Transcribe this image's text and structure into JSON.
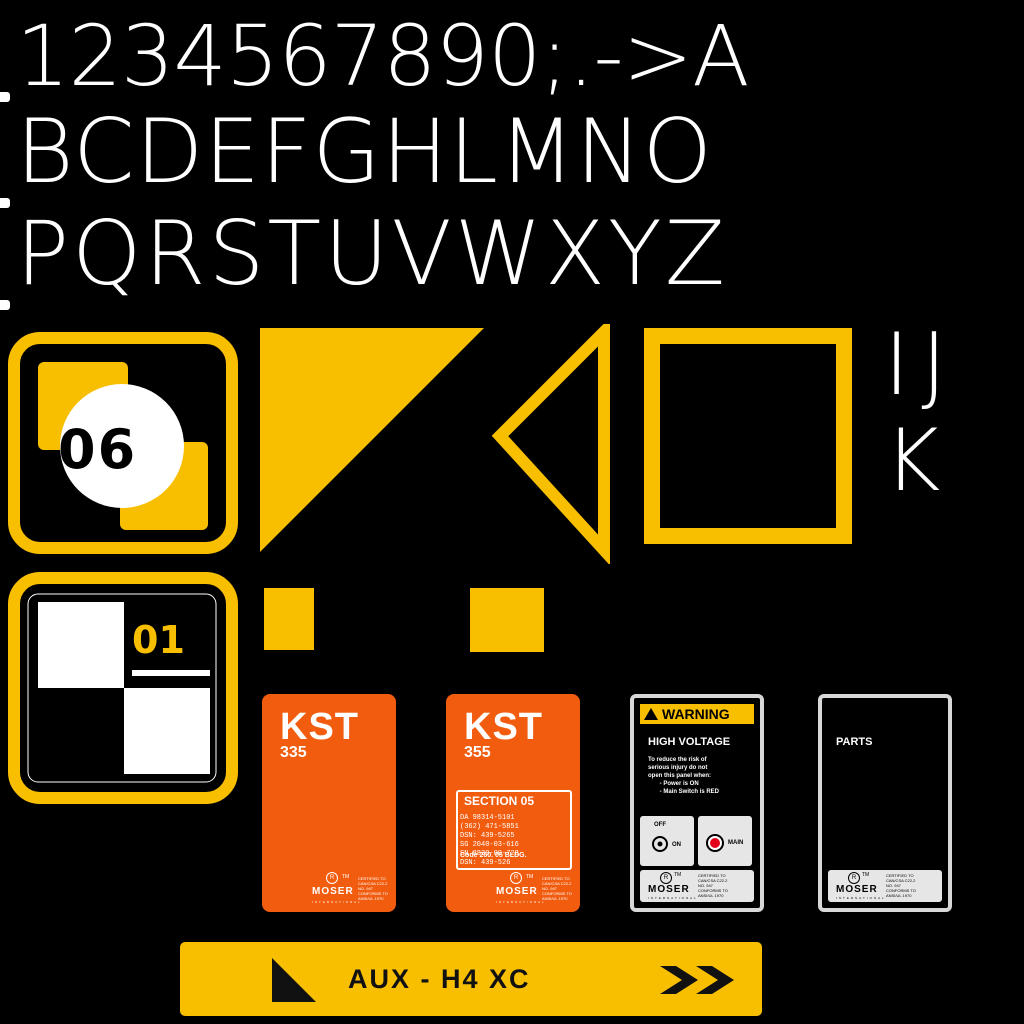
{
  "glyphs": {
    "row1": "1234567890;.->A",
    "row2": "BCDEFGHLMNO",
    "row3": "PQRSTUVWXYZ",
    "side1": "IJ",
    "side2": "K"
  },
  "badges": {
    "b06": "06",
    "b01": "01"
  },
  "cards": {
    "kst1": {
      "title": "KST",
      "num": "335"
    },
    "kst2": {
      "title": "KST",
      "num": "355",
      "section": "SECTION 05",
      "lines": "DA 98314-5101\n(362) 471-5851\nDSN: 439-5265\nSG 2040-03-616\nSN 8830-00-728\nDSN: 439-526",
      "code": "Code 260. 05 BLDG."
    },
    "brand": "MOSER",
    "brand_sub": "INTERNATIONAL",
    "reg": "R",
    "tm": "TM",
    "cert": "CERTIFIED TO\nCAN/CSA C22.2\nNO. 947\nCONFORMS TO\nANSI/UL 1970"
  },
  "warning_panel": {
    "bar": "WARNING",
    "head": "HIGH VOLTAGE",
    "text": "To reduce the risk of\nserious injury do not\nopen this panel when:\n       - Power is ON\n       - Main Switch is RED",
    "off": "OFF",
    "on": "ON",
    "main": "MAIN"
  },
  "parts_panel": {
    "head": "PARTS"
  },
  "aux_bar": {
    "label": "AUX - H4 XC"
  },
  "colors": {
    "yellow": "#f8be00",
    "orange": "#f15c0f",
    "panel_border": "#d8d8d8",
    "red": "#e3001b"
  }
}
